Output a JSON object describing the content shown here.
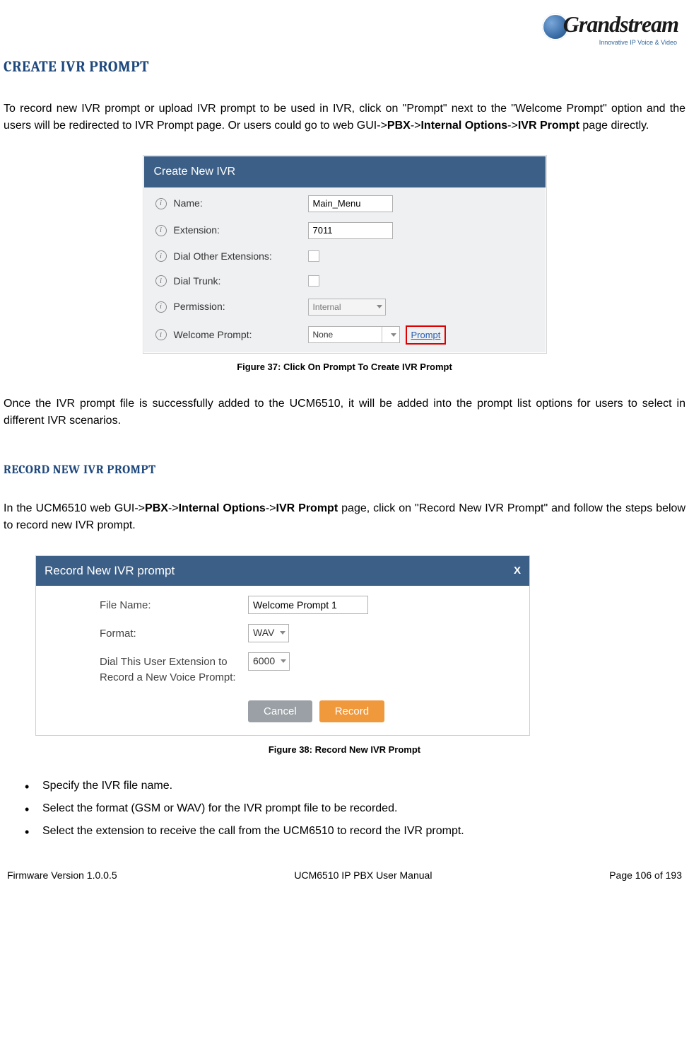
{
  "header": {
    "logo_text": "Grandstream",
    "tagline": "Innovative IP Voice & Video"
  },
  "section1": {
    "title": "CREATE IVR PROMPT",
    "para1_pre": "To record new IVR prompt or upload IVR prompt to be used in IVR, click on \"Prompt\" next to the \"Welcome Prompt\" option and the users will be redirected to IVR Prompt page. Or users could go to web GUI->",
    "bold1": "PBX",
    "arrow1": "->",
    "bold2": "Internal Options",
    "arrow2": "->",
    "bold3": "IVR Prompt",
    "para1_post": " page directly.",
    "figure_caption": "Figure 37: Click On Prompt To Create IVR Prompt",
    "para2": "Once the IVR prompt file is successfully added to the UCM6510, it will be added into the prompt list options for users to select in different IVR scenarios."
  },
  "figure1": {
    "panel_title": "Create New IVR",
    "rows": {
      "name_label": "Name:",
      "name_value": "Main_Menu",
      "ext_label": "Extension:",
      "ext_value": "7011",
      "dial_other_label": "Dial Other Extensions:",
      "dial_trunk_label": "Dial Trunk:",
      "perm_label": "Permission:",
      "perm_value": "Internal",
      "welcome_label": "Welcome Prompt:",
      "welcome_value": "None",
      "prompt_link": "Prompt"
    }
  },
  "section2": {
    "title": "RECORD NEW IVR PROMPT",
    "para_pre": "In the UCM6510 web GUI->",
    "bold1": "PBX",
    "arrow1": "->",
    "bold2": "Internal Options",
    "arrow2": "->",
    "bold3": "IVR Prompt",
    "para_post": " page, click on \"Record New IVR Prompt\" and follow the steps below to record new IVR prompt."
  },
  "figure2": {
    "panel_title": "Record New IVR prompt",
    "close": "X",
    "file_name_label": "File Name:",
    "file_name_value": "Welcome Prompt 1",
    "format_label": "Format:",
    "format_value": "WAV",
    "dial_label_line1": "Dial This User Extension to",
    "dial_label_line2": "Record a New Voice Prompt:",
    "dial_value": "6000",
    "cancel": "Cancel",
    "record": "Record",
    "caption": "Figure 38: Record New IVR Prompt"
  },
  "bullets": {
    "b1": "Specify the IVR file name.",
    "b2": "Select the format (GSM or WAV) for the IVR prompt file to be recorded.",
    "b3": "Select the extension to receive the call from the UCM6510 to record the IVR prompt."
  },
  "footer": {
    "left": "Firmware Version 1.0.0.5",
    "center": "UCM6510 IP PBX User Manual",
    "right": "Page 106 of 193"
  }
}
